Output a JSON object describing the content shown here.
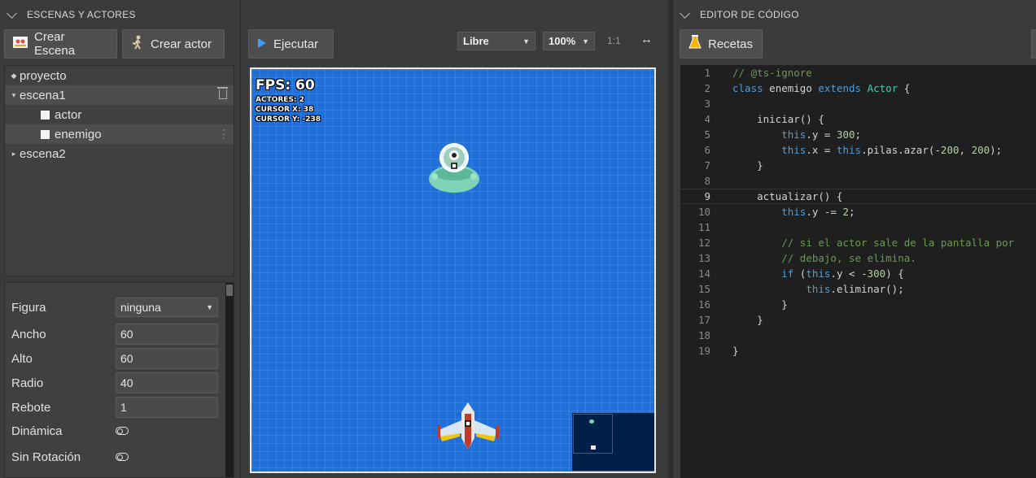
{
  "left_panel": {
    "header": "ESCENAS Y ACTORES",
    "create_scene_label": "Crear Escena",
    "create_actor_label": "Crear actor",
    "tree": {
      "project": "proyecto",
      "scene1": "escena1",
      "actor1": "actor",
      "actor2": "enemigo",
      "scene2": "escena2"
    },
    "properties": {
      "figure_label": "Figura",
      "figure_value": "ninguna",
      "width_label": "Ancho",
      "width_value": "60",
      "height_label": "Alto",
      "height_value": "60",
      "radius_label": "Radio",
      "radius_value": "40",
      "bounce_label": "Rebote",
      "bounce_value": "1",
      "dynamic_label": "Dinámica",
      "no_rotation_label": "Sin Rotación"
    }
  },
  "center_panel": {
    "run_label": "Ejecutar",
    "mode_value": "Libre",
    "zoom_value": "100%",
    "ratio_label": "1:1",
    "fullscreen_glyph": "↔",
    "hud": {
      "fps": "FPS: 60",
      "actors": "ACTORES: 2",
      "cursor_x": "CURSOR X: 38",
      "cursor_y": "CURSOR Y: -238"
    }
  },
  "right_panel": {
    "header": "EDITOR DE CÓDIGO",
    "recipes_label": "Recetas",
    "line_numbers": [
      "1",
      "2",
      "3",
      "4",
      "5",
      "6",
      "7",
      "8",
      "9",
      "10",
      "11",
      "12",
      "13",
      "14",
      "15",
      "16",
      "17",
      "18",
      "19"
    ],
    "active_line": 9
  },
  "colors": {
    "canvas_blue": "#1f6fd6",
    "run_icon": "#3aa0ff",
    "editor_bg": "#1f1f1f"
  },
  "icons": {
    "scene_icon": "scene-icon",
    "actor_icon": "actor-icon",
    "run_icon": "play-icon",
    "recipes_icon": "flask-icon"
  }
}
